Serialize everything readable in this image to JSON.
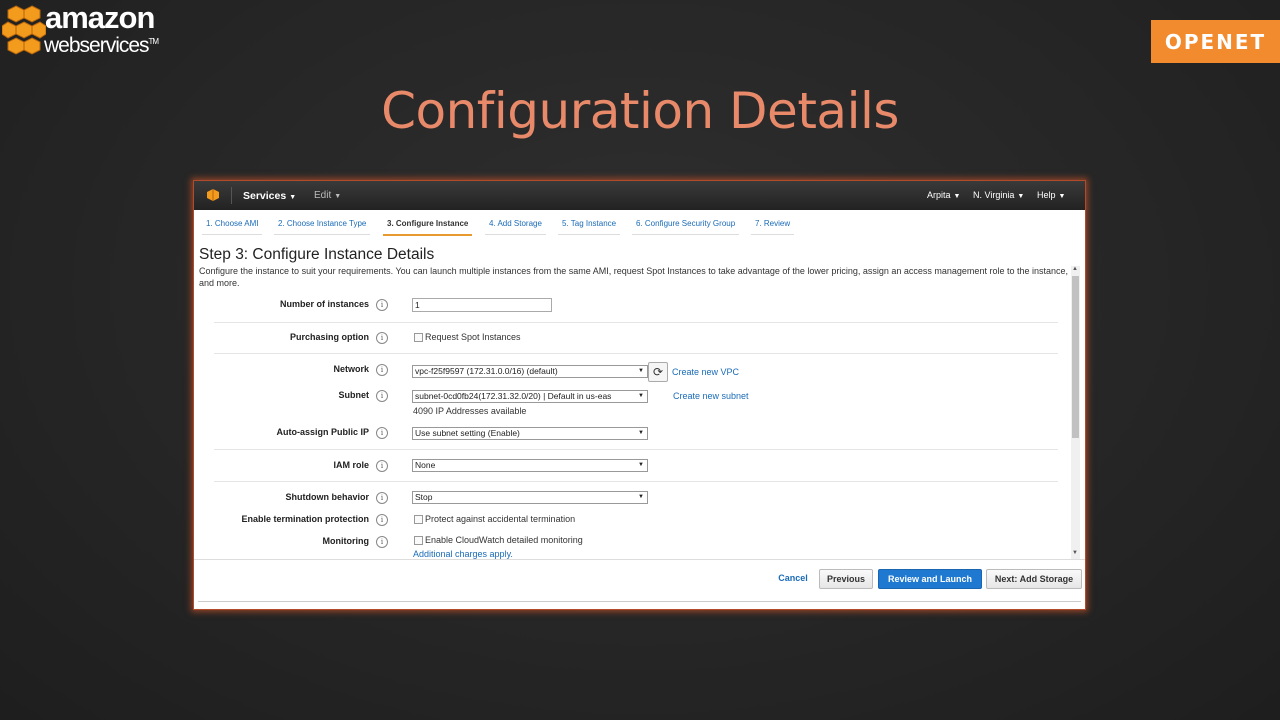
{
  "branding": {
    "aws_amazon": "amazon",
    "aws_webservices": "webservices",
    "aws_tm": "TM",
    "openet": "OPENET",
    "accent": "#f28a2e",
    "title_color": "#e8896a"
  },
  "slide": {
    "title": "Configuration Details"
  },
  "console": {
    "topbar": {
      "services": "Services",
      "edit": "Edit",
      "user": "Arpita",
      "region": "N. Virginia",
      "help": "Help"
    },
    "tabs": [
      {
        "label": "1. Choose AMI"
      },
      {
        "label": "2. Choose Instance Type"
      },
      {
        "label": "3. Configure Instance"
      },
      {
        "label": "4. Add Storage"
      },
      {
        "label": "5. Tag Instance"
      },
      {
        "label": "6. Configure Security Group"
      },
      {
        "label": "7. Review"
      }
    ],
    "active_tab": "3. Configure Instance",
    "heading": "Step 3: Configure Instance Details",
    "description": "Configure the instance to suit your requirements. You can launch multiple instances from the same AMI, request Spot Instances to take advantage of the lower pricing, assign an access management role to the instance, and more.",
    "form": {
      "instances": {
        "label": "Number of instances",
        "value": "1"
      },
      "purchasing": {
        "label": "Purchasing option",
        "checkbox": "Request Spot Instances"
      },
      "network": {
        "label": "Network",
        "value": "vpc-f25f9597 (172.31.0.0/16) (default)",
        "link": "Create new VPC"
      },
      "subnet": {
        "label": "Subnet",
        "value": "subnet-0cd0fb24(172.31.32.0/20) | Default in us-eas",
        "link": "Create new subnet",
        "note": "4090 IP Addresses available"
      },
      "public_ip": {
        "label": "Auto-assign Public IP",
        "value": "Use subnet setting (Enable)"
      },
      "iam": {
        "label": "IAM role",
        "value": "None"
      },
      "shutdown": {
        "label": "Shutdown behavior",
        "value": "Stop"
      },
      "termination": {
        "label": "Enable termination protection",
        "checkbox": "Protect against accidental termination"
      },
      "monitoring": {
        "label": "Monitoring",
        "checkbox": "Enable CloudWatch detailed monitoring",
        "link": "Additional charges apply."
      }
    },
    "buttons": {
      "cancel": "Cancel",
      "previous": "Previous",
      "review_launch": "Review and Launch",
      "next": "Next: Add Storage"
    }
  }
}
